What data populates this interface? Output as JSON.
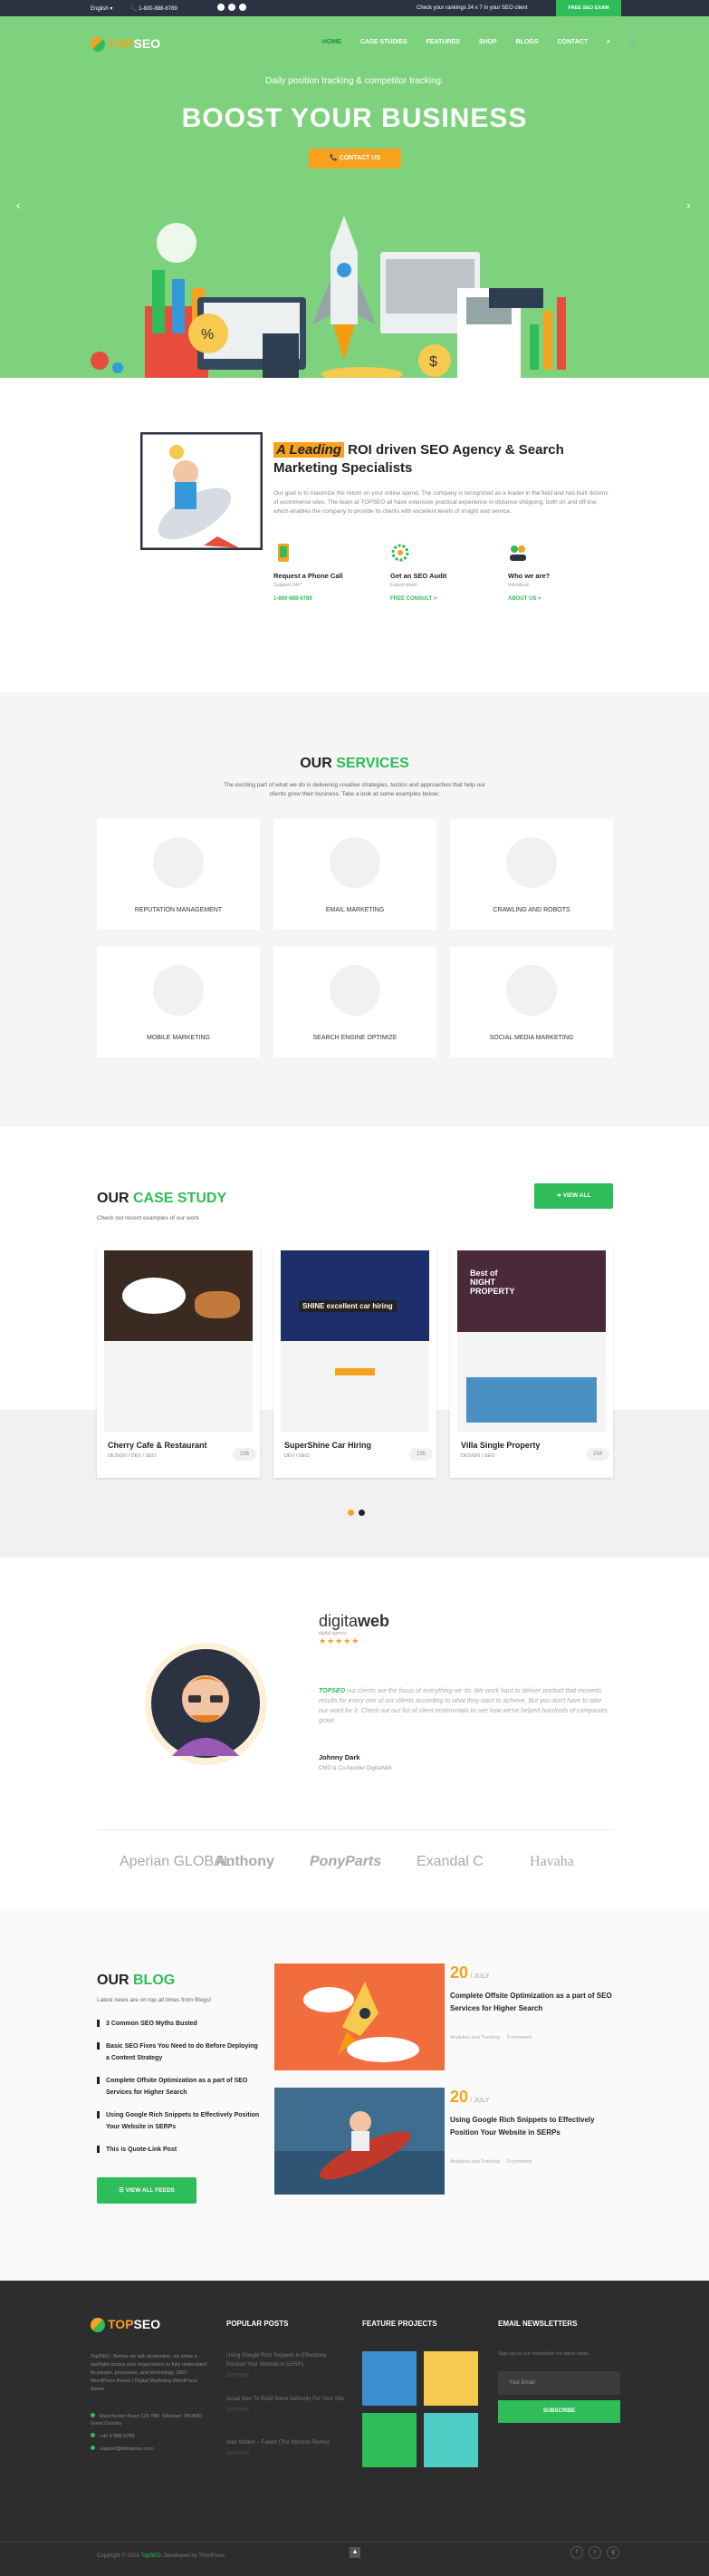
{
  "topbar": {
    "language": "English ▾",
    "phone": "📞 1-800-888-6789",
    "check": "Check your rankings 24 x 7 in your SEO client",
    "free_button": "FREE SEO EXAM"
  },
  "header": {
    "logo_prefix": "TOP",
    "logo_suffix": "SEO",
    "nav": [
      "HOME",
      "CASE STUDIES",
      "FEATURES",
      "SHOP",
      "BLOGS",
      "CONTACT"
    ],
    "search_glyph": "⌕",
    "cart_glyph": "🛒"
  },
  "hero": {
    "subtitle": "Daily position tracking & competitor tracking.",
    "title": "BOOST YOUR BUSINESS",
    "button": "📞 CONTACT US",
    "prev": "‹",
    "next": "›"
  },
  "about": {
    "highlight": "A Leading",
    "title_rest": " ROI driven SEO Agency & Search Marketing Specialists",
    "desc": "Our goal is to maximize the return on your online spend. The company is recognized as a leader in the field and has built dozens of ecommerce sites. The team at TOPSEO all have extensive practical experience in distance shopping, both on and off-line, which enables the company to provide its clients with excellent levels of insight and service.",
    "features": [
      {
        "title": "Request a Phone Call",
        "sub": "Support 24/7",
        "link": "1-800-888-6789"
      },
      {
        "title": "Get an SEO Audit",
        "sub": "Expert team",
        "link": "FREE CONSULT >"
      },
      {
        "title": "Who we are?",
        "sub": "Introduce",
        "link": "ABOUT US >"
      }
    ]
  },
  "services": {
    "title_a": "OUR ",
    "title_b": "SERVICES",
    "sub": "The exciting part of what we do is delivering creative strategies, tactics and approaches that help our clients grow their business. Take a look at some examples below:",
    "items": [
      "REPUTATION MANAGEMENT",
      "EMAIL MARKETING",
      "CRAWLING AND ROBOTS",
      "MOBILE MARKETING",
      "SEARCH ENGINE OPTIMIZE",
      "SOCIAL MEDIA MARKETING"
    ]
  },
  "case": {
    "title_a": "OUR ",
    "title_b": "CASE STUDY",
    "sub": "Check out recent examples of our work",
    "view_all": "➜ VIEW ALL",
    "projects": [
      {
        "name": "Cherry Cafe & Restaurant",
        "cat": "DESIGN / DEV / SEO",
        "count": "236"
      },
      {
        "name": "SuperShine Car Hiring",
        "cat": "DEV / SEO",
        "count": "235"
      },
      {
        "name": "Villa Single Property",
        "cat": "DESIGN / SEO",
        "count": "234"
      }
    ],
    "shot_texts": [
      "SHINE excellent car hiring",
      "Best of NIGHT PROPERTY"
    ]
  },
  "testimonial": {
    "brand_a": "digita",
    "brand_b": "web",
    "brand_sub": "digital agency",
    "stars": "★★★★★",
    "quote_brand": "TOPSEO",
    "quote": " our clients are the focus of everything we do. We work hard to deliver product that exceeds results for every one of our clients according to what they want to achieve. But you don't have to take our word for it. Check out our list of client testimonials to see how we've helped hundreds of companies grow!",
    "name": "Johnny Dark",
    "role": "CMO & Co-founder DigitaWeb",
    "clients": [
      "Aperian GLOBAL",
      "Anthony",
      "PonyParts",
      "Exandal C",
      "Havaha"
    ]
  },
  "blog": {
    "title_a": "OUR ",
    "title_b": "BLOG",
    "sub": "Latest news are on top all times from Blogs!",
    "list": [
      "3 Common SEO Myths Busted",
      "Basic SEO Fixes You Need to do Before Deploying a Content Strategy",
      "Complete Offsite Optimization as a part of SEO Services for Higher Search",
      "Using Google Rich Snippets to Effectively Position Your Website in SERPs",
      "This is Quote-Link Post"
    ],
    "view_all": "☰ VIEW ALL FEEDS",
    "posts": [
      {
        "day": "20",
        "month": "/ JULY",
        "title": "Complete Offsite Optimization as a part of SEO Services for Higher Search",
        "cat": "Analytics and Tracking",
        "comments": "0 comment"
      },
      {
        "day": "20",
        "month": "/ JULY",
        "title": "Using Google Rich Snippets to Effectively Position Your Website in SERPs",
        "cat": "Analytics and Tracking",
        "comments": "0 comment"
      }
    ]
  },
  "footer": {
    "logo_prefix": "TOP",
    "logo_suffix": "SEO",
    "desc": "TopSEO - Before we talk destination, we shine a spotlight across your organization to fully understand its people, processes, and technology. SEO WordPress theme | Digital Marketing WordPress theme.",
    "address": "Manchester Road 123-78B, Silictown 7854MD, Great Country",
    "phone": "+46 8 888 6789",
    "email": "support@thimpress.com",
    "col_posts": "POPULAR POSTS",
    "col_proj": "FEATURE PROJECTS",
    "col_news": "EMAIL NEWSLETTERS",
    "posts": [
      {
        "title": "Using Google Rich Snippets to Effectively Position Your Website in SERPs",
        "date": "20/07/2016"
      },
      {
        "title": "Great Men To Build Some Authority For Your Site",
        "date": "20/07/2016"
      },
      {
        "title": "Alan Walker – Faded (The Winston Remix)",
        "date": "20/07/2016"
      }
    ],
    "news_sub": "Sign up for our newsletter for latest news.",
    "email_ph": "Your Email",
    "subscribe": "SUBSCRIBE",
    "copy_a": "Copyright © 2016 ",
    "copy_b": "TopSEO",
    "copy_c": ". Developed by ThimPress",
    "up": "▲",
    "social": [
      "f",
      "t",
      "g"
    ]
  },
  "colors": {
    "green": "#7ed27e",
    "accent_green": "#2ebd59",
    "orange": "#f6a21f",
    "dark": "#2b3343"
  }
}
